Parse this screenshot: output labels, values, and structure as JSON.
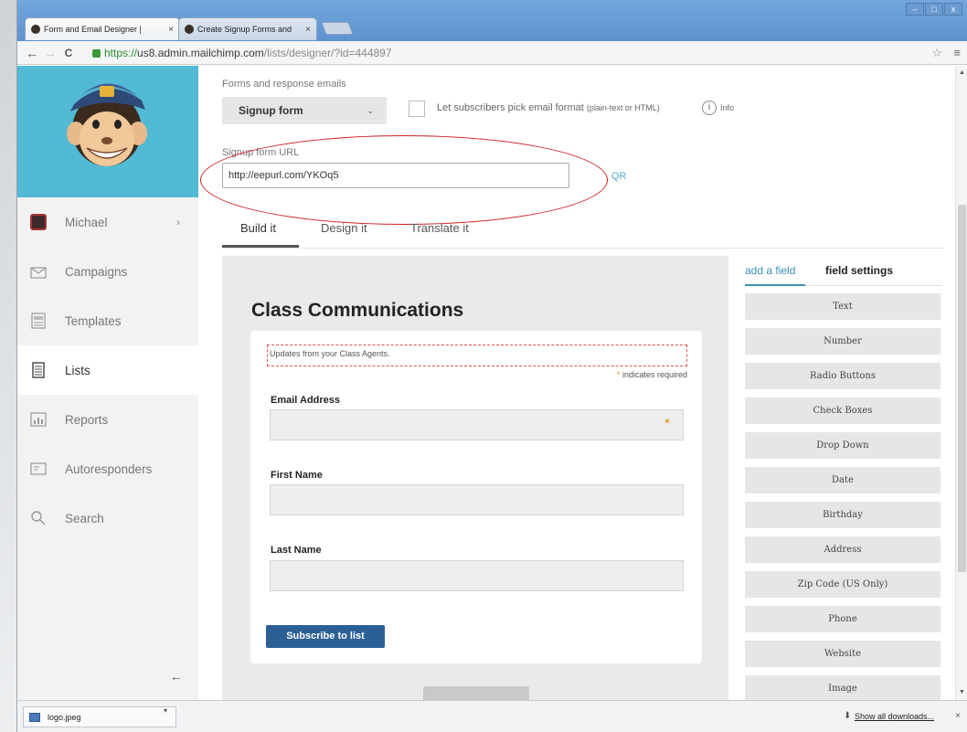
{
  "browser": {
    "tabs": [
      {
        "title": "Form and Email Designer | "
      },
      {
        "title": "Create Signup Forms and "
      }
    ],
    "url": {
      "scheme": "https://",
      "host": "us8.admin.mailchimp.com",
      "path": "/lists/designer/?id=444897"
    },
    "window_buttons": {
      "minimize": "–",
      "maximize": "□",
      "close": "x"
    },
    "tab_close": "×",
    "nav": {
      "back": "←",
      "forward": "→",
      "reload": "C"
    },
    "star": "☆",
    "menu": "≡"
  },
  "sidebar": {
    "items": [
      {
        "label": "Michael",
        "icon": "avatar-icon",
        "chevron": "›"
      },
      {
        "label": "Campaigns",
        "icon": "envelope-icon"
      },
      {
        "label": "Templates",
        "icon": "template-icon"
      },
      {
        "label": "Lists",
        "icon": "list-icon",
        "active": true
      },
      {
        "label": "Reports",
        "icon": "bar-chart-icon"
      },
      {
        "label": "Autoresponders",
        "icon": "autoresponder-icon"
      },
      {
        "label": "Search",
        "icon": "search-icon"
      }
    ],
    "collapse": "←"
  },
  "header": {
    "forms_label": "Forms and response emails",
    "form_select": "Signup form",
    "select_caret": "⌄",
    "format_checkbox_label": "Let subscribers pick email format",
    "format_checkbox_note": "(plain-text or HTML)",
    "info_icon": "i",
    "info_label": "Info",
    "url_label": "Signup form URL",
    "url_value": "http://eepurl.com/YKOq5",
    "qr": "QR"
  },
  "builder_tabs": [
    {
      "label": "Build it",
      "active": true
    },
    {
      "label": "Design it"
    },
    {
      "label": "Translate it"
    }
  ],
  "form": {
    "title": "Class Communications",
    "tagline": "Updates from your Class Agents.",
    "required_star": "*",
    "required_note": "indicates required",
    "fields": [
      {
        "label": "Email Address",
        "required": true
      },
      {
        "label": "First Name"
      },
      {
        "label": "Last Name"
      }
    ],
    "subscribe": "Subscribe to list"
  },
  "right_panel": {
    "tab_add": "add a field",
    "tab_settings": "field settings",
    "field_types": [
      "Text",
      "Number",
      "Radio Buttons",
      "Check Boxes",
      "Drop Down",
      "Date",
      "Birthday",
      "Address",
      "Zip Code (US Only)",
      "Phone",
      "Website",
      "Image"
    ]
  },
  "downloads": {
    "file": "logo.jpeg",
    "arrow": "▾",
    "show_all": "Show all downloads...",
    "download_icon": "⬇",
    "close": "×"
  },
  "colors": {
    "sidebar_header": "#52bad5",
    "subscribe_button": "#2c5f94",
    "link": "#3d8db5",
    "annotation": "#d11c1c",
    "required": "#e08a14"
  }
}
